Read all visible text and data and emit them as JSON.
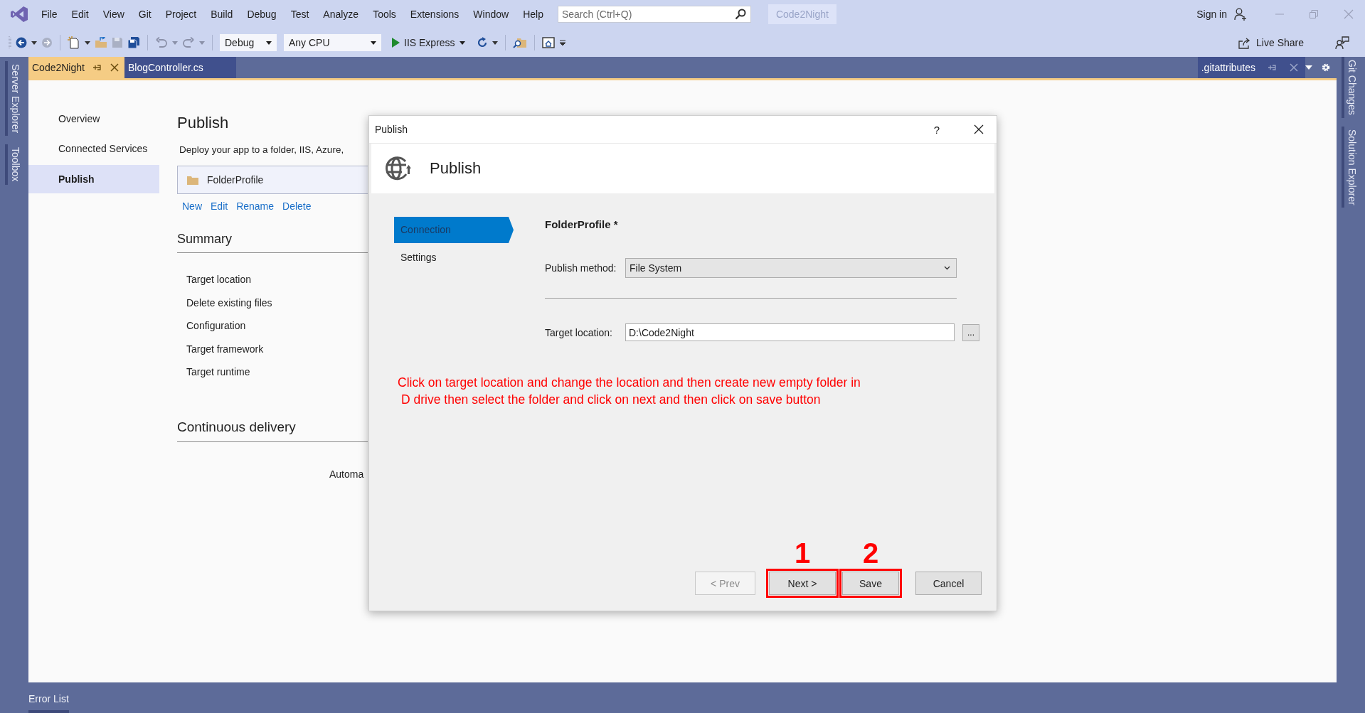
{
  "menu": [
    "File",
    "Edit",
    "View",
    "Git",
    "Project",
    "Build",
    "Debug",
    "Test",
    "Analyze",
    "Tools",
    "Extensions",
    "Window",
    "Help"
  ],
  "search": {
    "placeholder": "Search (Ctrl+Q)"
  },
  "solution_badge": "Code2Night",
  "account": {
    "label": "Sign in"
  },
  "toolbar": {
    "configuration": "Debug",
    "platform": "Any CPU",
    "run_target": "IIS Express",
    "live_share": "Live Share"
  },
  "left_tool_tabs": [
    "Server Explorer",
    "Toolbox"
  ],
  "right_tool_tabs": [
    "Git Changes",
    "Solution Explorer"
  ],
  "doc_tabs": [
    {
      "label": "Code2Night",
      "selected": true,
      "pinned": true
    },
    {
      "label": "BlogController.cs",
      "selected": false,
      "pinned": false
    }
  ],
  "right_doc_tabs": [
    {
      "label": ".gitattributes",
      "selected": false,
      "pinned": true
    }
  ],
  "page": {
    "nav": [
      {
        "label": "Overview",
        "selected": false
      },
      {
        "label": "Connected Services",
        "selected": false
      },
      {
        "label": "Publish",
        "selected": true
      }
    ],
    "title": "Publish",
    "description": "Deploy your app to a folder, IIS, Azure,",
    "profile": "FolderProfile",
    "actions": [
      "New",
      "Edit",
      "Rename",
      "Delete"
    ],
    "summary": {
      "title": "Summary",
      "items": [
        "Target location",
        "Delete existing files",
        "Configuration",
        "Target framework",
        "Target runtime"
      ]
    },
    "continuous_delivery": {
      "title": "Continuous delivery",
      "text": "Automa"
    }
  },
  "dialog": {
    "title": "Publish",
    "help": "?",
    "header": "Publish",
    "steps": [
      {
        "label": "Connection",
        "selected": true
      },
      {
        "label": "Settings",
        "selected": false
      }
    ],
    "profile_name": "FolderProfile *",
    "method_label": "Publish method:",
    "method": "File System",
    "location_label": "Target location:",
    "location": "D:\\Code2Night",
    "browse": "...",
    "note": [
      "Click on target location and change the location and then create new empty folder in",
      "D drive then select the folder and click on next and then click on save button"
    ],
    "buttons": [
      {
        "label": "< Prev",
        "disabled": true
      },
      {
        "label": "Next >",
        "disabled": false,
        "annotation": "1"
      },
      {
        "label": "Save",
        "disabled": false,
        "annotation": "2"
      },
      {
        "label": "Cancel",
        "disabled": false
      }
    ]
  },
  "status_bar": {
    "label": "Error List"
  }
}
